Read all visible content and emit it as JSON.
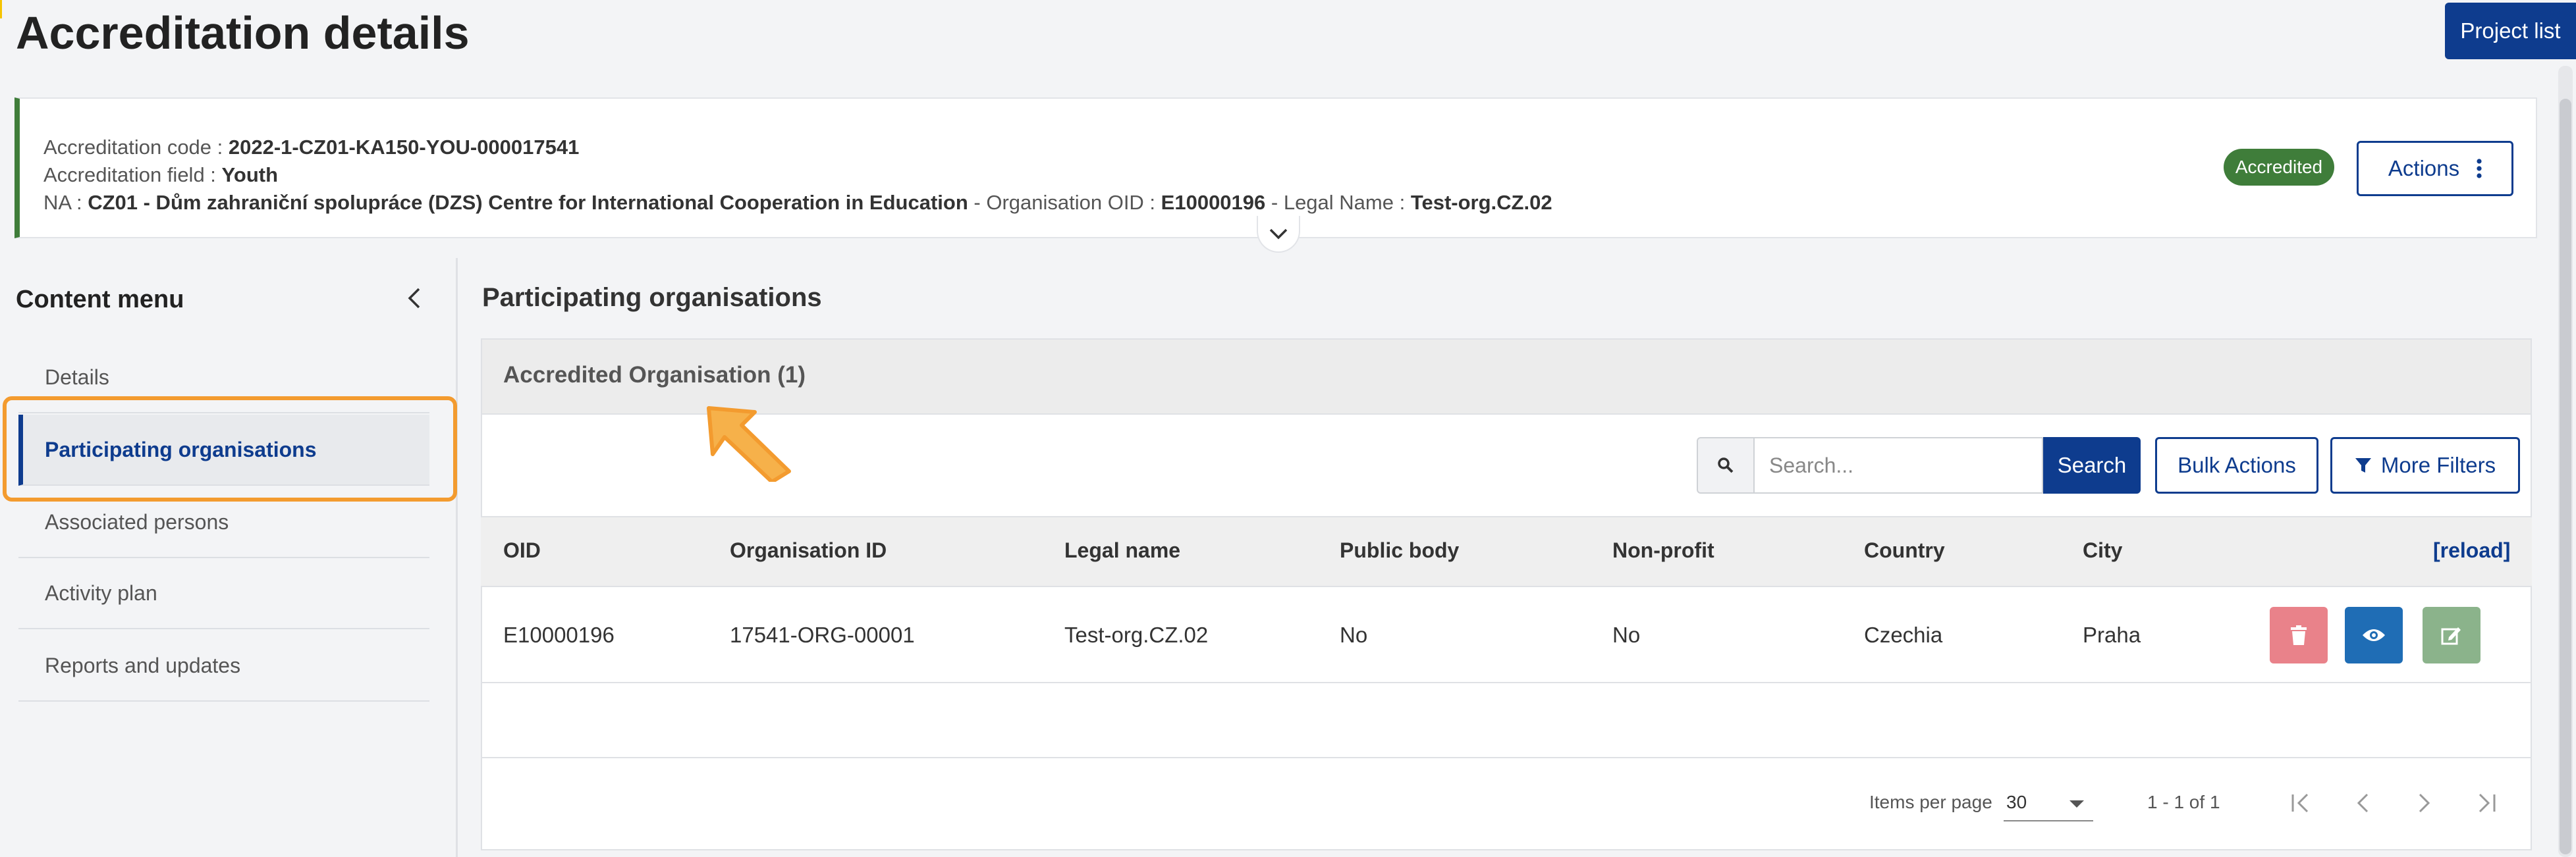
{
  "page": {
    "title": "Accreditation details",
    "project_list_label": "Project list"
  },
  "header": {
    "accreditation_code_label": "Accreditation code : ",
    "accreditation_code": "2022-1-CZ01-KA150-YOU-000017541",
    "accreditation_field_label": "Accreditation field : ",
    "accreditation_field": "Youth",
    "na_label": "NA : ",
    "na_value": "CZ01 - Dům zahraniční spolupráce (DZS) Centre for International Cooperation in Education",
    "oid_label": " - Organisation OID : ",
    "oid_value": "E10000196",
    "legal_label": " - Legal Name : ",
    "legal_value": "Test-org.CZ.02",
    "status": "Accredited",
    "actions_label": "Actions",
    "colors": {
      "accent": "#3f7d3a",
      "brand": "#0e3c8e"
    }
  },
  "sidebar": {
    "title": "Content menu",
    "items": [
      {
        "label": "Details"
      },
      {
        "label": "Participating organisations"
      },
      {
        "label": "Associated persons"
      },
      {
        "label": "Activity plan"
      },
      {
        "label": "Reports and updates"
      }
    ],
    "active_index": 1,
    "highlight_color": "#f39b2f"
  },
  "main": {
    "section_title": "Participating organisations",
    "panel_title": "Accredited Organisation (1)",
    "search": {
      "placeholder": "Search...",
      "value": "",
      "button_label": "Search"
    },
    "bulk_actions_label": "Bulk Actions",
    "more_filters_label": "More Filters",
    "table": {
      "columns": [
        "OID",
        "Organisation ID",
        "Legal name",
        "Public body",
        "Non-profit",
        "Country",
        "City"
      ],
      "reload_label": "[reload]",
      "rows": [
        [
          "E10000196",
          "17541-ORG-00001",
          "Test-org.CZ.02",
          "No",
          "No",
          "Czechia",
          "Praha"
        ]
      ],
      "row_actions": [
        "trash-icon",
        "eye-icon",
        "edit-icon"
      ]
    },
    "paginator": {
      "items_per_page_label": "Items per page",
      "items_per_page": "30",
      "range_label": "1 - 1 of 1"
    }
  }
}
